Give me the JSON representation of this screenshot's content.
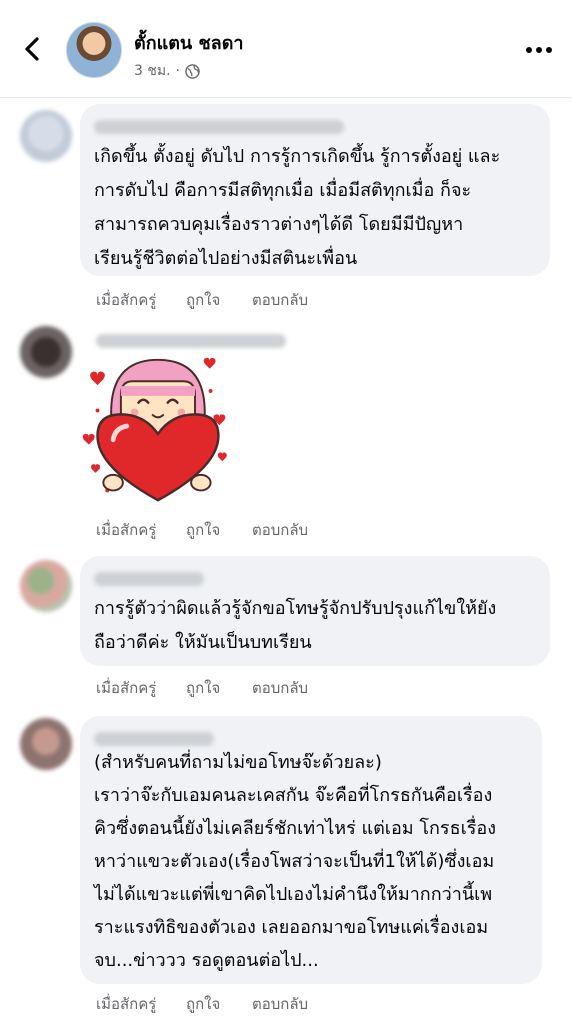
{
  "header": {
    "name": "ตั้กแตน ชลดา",
    "time": "3 ชม.",
    "separator": "·"
  },
  "comments": [
    {
      "lines": [
        "เกิดขึ้น ตั้งอยู่ ดับไป การรู้การเกิดขึ้น รู้การตั้งอยู่ และ",
        "การดับไป คือการมีสติทุกเมื่อ เมื่อมีสติทุกเมื่อ ก็จะ",
        "สามารถควบคุมเรื่องราวต่างๆได้ดี โดยมีมีปัญหา",
        "เรียนรู้ชีวิตต่อไปอย่างมีสตินะเพื่อน"
      ],
      "time": "เมื่อสักครู่",
      "like": "ถูกใจ",
      "reply": "ตอบกลับ"
    },
    {
      "sticker": "heart-hug-sticker",
      "time": "เมื่อสักครู่",
      "like": "ถูกใจ",
      "reply": "ตอบกลับ"
    },
    {
      "lines": [
        "การรู้ตัวว่าผิดแล้วรู้จักขอโทษรู้จักปรับปรุงแก้ไขให้ยัง",
        "ถือว่าดีค่ะ ให้มันเป็นบทเรียน"
      ],
      "time": "เมื่อสักครู่",
      "like": "ถูกใจ",
      "reply": "ตอบกลับ"
    },
    {
      "lines": [
        "(สำหรับคนที่ถามไม่ขอโทษจ๊ะด้วยละ)",
        "เราว่าจ๊ะกับเอมคนละเคสกัน จ๊ะคือที่โกรธกันคือเรื่อง",
        "คิวซึ่งตอนนี้ยังไม่เคลียร์ชักเท่าไหร่ แต่เอม โกรธเรื่อง",
        "หาว่าแขวะตัวเอง(เรื่องโพสว่าจะเป็นที่1ให้ได้)ซึ่งเอม",
        "ไม่ได้แขวะแต่พี่เขาคิดไปเองไม่คำนึงให้มากกว่านี้เพ",
        "ราะแรงทิธิของตัวเอง เลยออกมาขอโทษแค่เรื่องเอม",
        "จบ...ข่าววว รอดูตอนต่อไป..."
      ],
      "time": "เมื่อสักครู่",
      "like": "ถูกใจ",
      "reply": "ตอบกลับ"
    }
  ],
  "icons": {
    "back": "chevron-left-icon",
    "more": "more-dots-icon",
    "privacy": "globe-icon"
  },
  "colors": {
    "bubble": "#f0f2f5",
    "meta": "#65676b",
    "text": "#050505"
  }
}
